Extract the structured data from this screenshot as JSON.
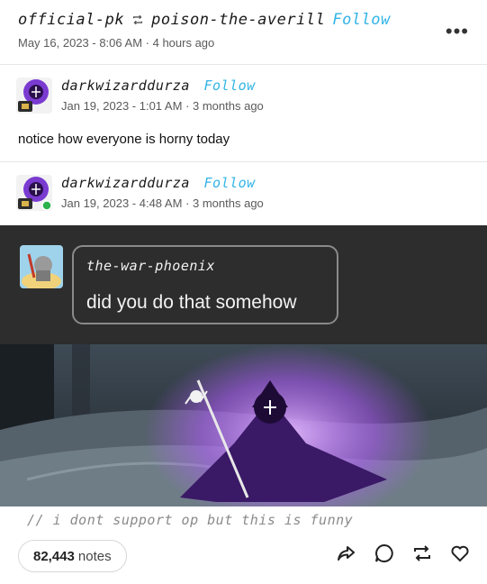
{
  "header": {
    "author": "official-pk",
    "reblogged_from": "poison-the-averill",
    "follow_label": "Follow",
    "timestamp": "May 16, 2023 - 8:06 AM",
    "relative_time": "4 hours ago",
    "more_label": "•••"
  },
  "trail": [
    {
      "username": "darkwizarddurza",
      "follow_label": "Follow",
      "timestamp": "Jan 19, 2023 - 1:01 AM",
      "relative_time": "3 months ago",
      "body": "notice how everyone is horny today"
    },
    {
      "username": "darkwizarddurza",
      "follow_label": "Follow",
      "timestamp": "Jan 19, 2023 - 4:48 AM",
      "relative_time": "3 months ago"
    }
  ],
  "embedded_reply": {
    "username": "the-war-phoenix",
    "text": "did you do that somehow"
  },
  "caption": "// i dont support op but this is funny",
  "footer": {
    "notes_count": "82,443",
    "notes_label": "notes"
  },
  "colors": {
    "follow": "#32b4e6",
    "dark_panel": "#2d2d2d",
    "purple_glow": "#b35cff"
  },
  "icons": [
    "reblog-mini-icon",
    "more-icon",
    "share-icon",
    "reply-icon",
    "reblog-icon",
    "like-icon"
  ]
}
